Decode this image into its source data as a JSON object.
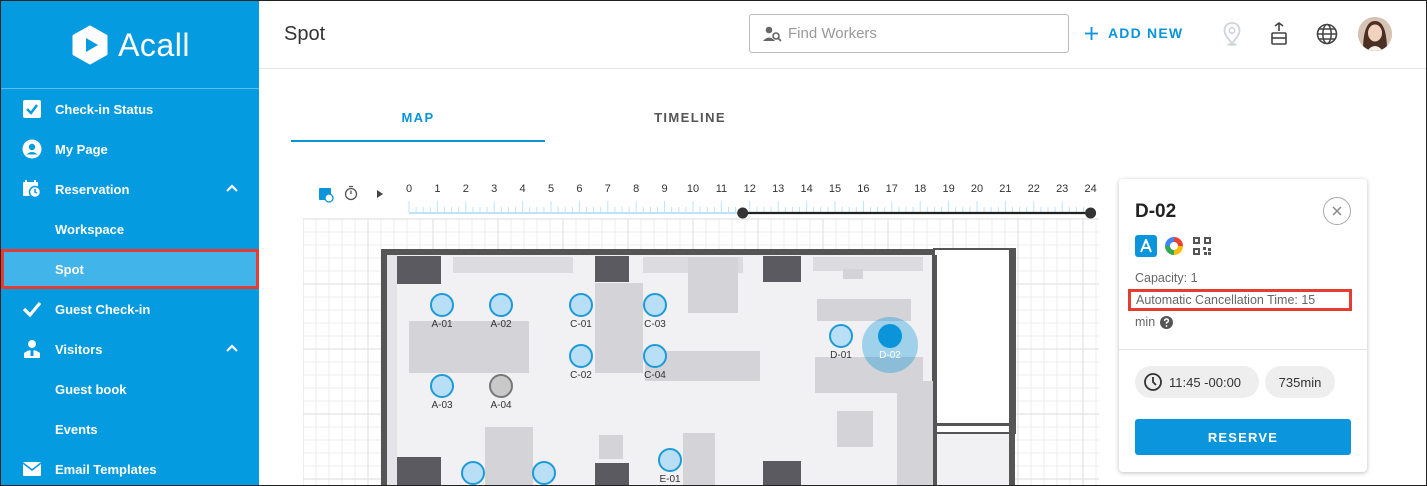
{
  "app": {
    "brand": "Acall",
    "page_title": "Spot"
  },
  "colors": {
    "brand_blue": "#059be0",
    "accent": "#0a94d9",
    "highlight": "#e53b30"
  },
  "sidebar": {
    "items": [
      {
        "label": "Check-in Status",
        "icon": "checkbox-icon"
      },
      {
        "label": "My Page",
        "icon": "user-circle-icon"
      },
      {
        "label": "Reservation",
        "icon": "calendar-clock-icon",
        "expanded": true
      },
      {
        "label": "Workspace"
      },
      {
        "label": "Spot",
        "active": true
      },
      {
        "label": "Guest Check-in",
        "icon": "check-icon"
      },
      {
        "label": "Visitors",
        "icon": "visitor-icon",
        "expanded": true
      },
      {
        "label": "Guest book"
      },
      {
        "label": "Events"
      },
      {
        "label": "Email Templates",
        "icon": "mail-icon"
      }
    ]
  },
  "topbar": {
    "search_placeholder": "Find Workers",
    "add_new_label": "ADD NEW"
  },
  "tabs": [
    {
      "label": "MAP",
      "active": true
    },
    {
      "label": "TIMELINE"
    }
  ],
  "timeline": {
    "hours": [
      "0",
      "1",
      "2",
      "3",
      "4",
      "5",
      "6",
      "7",
      "8",
      "9",
      "10",
      "11",
      "12",
      "13",
      "14",
      "15",
      "16",
      "17",
      "18",
      "19",
      "20",
      "21",
      "22",
      "23",
      "24"
    ],
    "selected_start_hour": 11.75,
    "selected_end_hour": 24
  },
  "spots": [
    {
      "id": "A-01",
      "state": "available"
    },
    {
      "id": "A-02",
      "state": "available"
    },
    {
      "id": "A-03",
      "state": "available"
    },
    {
      "id": "A-04",
      "state": "unavailable"
    },
    {
      "id": "C-01",
      "state": "available"
    },
    {
      "id": "C-02",
      "state": "available"
    },
    {
      "id": "C-03",
      "state": "available"
    },
    {
      "id": "C-04",
      "state": "available"
    },
    {
      "id": "D-01",
      "state": "available"
    },
    {
      "id": "D-02",
      "state": "selected"
    },
    {
      "id": "E-01",
      "state": "available"
    }
  ],
  "detail": {
    "title": "D-02",
    "capacity": "Capacity: 1",
    "auto_cancel": "Automatic Cancellation Time: 15",
    "auto_cancel_unit": "min",
    "start_time": "11:45 -00:00",
    "duration": "735min",
    "reserve_label": "RESERVE"
  }
}
